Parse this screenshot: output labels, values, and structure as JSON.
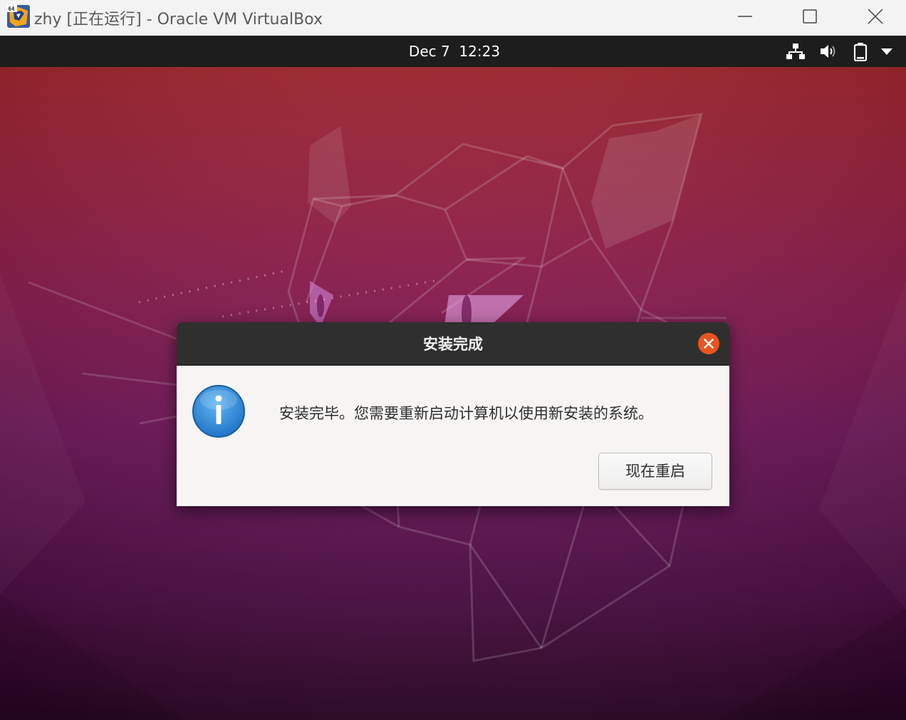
{
  "host_window": {
    "title": "zhy [正在运行] - Oracle VM VirtualBox",
    "app_icon": "virtualbox-icon",
    "app_icon_badge": "64",
    "controls": [
      "minimize-icon",
      "maximize-icon",
      "close-icon"
    ]
  },
  "top_bar": {
    "date": "Dec 7",
    "time": "12:23",
    "tray_icons": [
      "network-icon",
      "volume-icon",
      "battery-icon",
      "system-menu-arrow-icon"
    ]
  },
  "dialog": {
    "title": "安装完成",
    "message": "安装完毕。您需要重新启动计算机以使用新安装的系统。",
    "icon": "info-icon",
    "close_icon": "dialog-close-icon",
    "restart_label": "现在重启"
  },
  "colors": {
    "accent_orange": "#e95420",
    "top_bar": "#1d1d1d",
    "dialog_header": "#2f2f2f",
    "wallpaper_top": "#a5272f",
    "wallpaper_mid": "#7a1450",
    "wallpaper_bottom": "#2c0626",
    "info_blue": "#2a7fd4"
  }
}
